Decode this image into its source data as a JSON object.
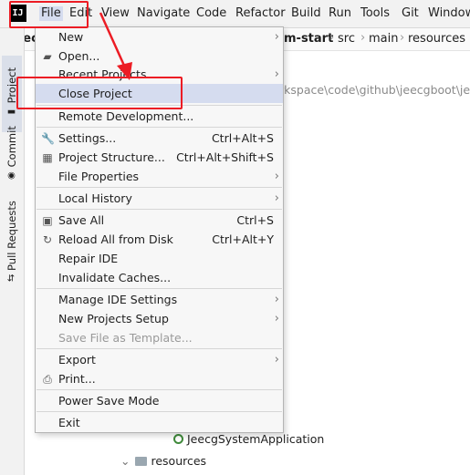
{
  "menubar": {
    "logo": "IJ",
    "items": [
      "File",
      "Edit",
      "View",
      "Navigate",
      "Code",
      "Refactor",
      "Build",
      "Run",
      "Tools",
      "Git",
      "Window"
    ]
  },
  "side_tabs": [
    "Project",
    "Commit",
    "Pull Requests"
  ],
  "navbar": {
    "project": "jeecg",
    "crumbs": [
      "m-start",
      "src",
      "main",
      "resources"
    ]
  },
  "background": {
    "path": "rkspace\\code\\github\\jeecgboot\\jee",
    "tree_app": "JeecgSystemApplication",
    "tree_folder": "resources"
  },
  "file_menu": {
    "items": [
      {
        "label": "New",
        "shortcut": "",
        "submenu": true
      },
      {
        "label": "Open...",
        "shortcut": "",
        "submenu": false
      },
      {
        "label": "Recent Projects",
        "shortcut": "",
        "submenu": true
      },
      {
        "label": "Close Project",
        "shortcut": "",
        "submenu": false
      },
      {
        "label": "Remote Development...",
        "shortcut": "",
        "submenu": false
      },
      {
        "label": "Settings...",
        "shortcut": "Ctrl+Alt+S",
        "submenu": false
      },
      {
        "label": "Project Structure...",
        "shortcut": "Ctrl+Alt+Shift+S",
        "submenu": false
      },
      {
        "label": "File Properties",
        "shortcut": "",
        "submenu": true
      },
      {
        "label": "Local History",
        "shortcut": "",
        "submenu": true
      },
      {
        "label": "Save All",
        "shortcut": "Ctrl+S",
        "submenu": false
      },
      {
        "label": "Reload All from Disk",
        "shortcut": "Ctrl+Alt+Y",
        "submenu": false
      },
      {
        "label": "Repair IDE",
        "shortcut": "",
        "submenu": false
      },
      {
        "label": "Invalidate Caches...",
        "shortcut": "",
        "submenu": false
      },
      {
        "label": "Manage IDE Settings",
        "shortcut": "",
        "submenu": true
      },
      {
        "label": "New Projects Setup",
        "shortcut": "",
        "submenu": true
      },
      {
        "label": "Save File as Template...",
        "shortcut": "",
        "submenu": false
      },
      {
        "label": "Export",
        "shortcut": "",
        "submenu": true
      },
      {
        "label": "Print...",
        "shortcut": "",
        "submenu": false
      },
      {
        "label": "Power Save Mode",
        "shortcut": "",
        "submenu": false
      },
      {
        "label": "Exit",
        "shortcut": "",
        "submenu": false
      }
    ]
  },
  "colors": {
    "highlight": "#d5dcef",
    "annotation": "#ec1c24",
    "disabled_text": "#9a9a9a"
  }
}
